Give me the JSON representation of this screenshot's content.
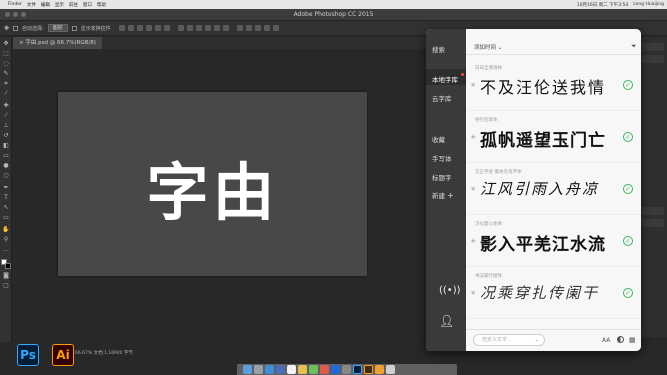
{
  "menubar": {
    "items": [
      "Finder",
      "文件",
      "编辑",
      "显示",
      "前往",
      "窗口",
      "帮助"
    ],
    "right": [
      "10月16日 周二 下午3:54",
      "Leng Huaijing"
    ]
  },
  "app": {
    "title": "Adobe Photoshop CC 2015"
  },
  "options": {
    "auto_select_label": "自动选择:",
    "layer_select": "图层",
    "transform_label": "显示变换控件"
  },
  "document": {
    "tab": "字由.psd @ 66.7%(RGB/8)",
    "canvas_text": "字由",
    "status": "66.67%   文档:1.16M/0 字节"
  },
  "apps": {
    "ps": "Ps",
    "ai": "Ai"
  },
  "panel": {
    "sidebar": {
      "search": "搜索",
      "local": "本地字库",
      "cloud": "云字库",
      "favorites": "收藏",
      "handwriting": "手写体",
      "title_font": "标题字",
      "new": "新建",
      "new_plus": "+"
    },
    "sort_label": "添加时间 ⌄",
    "fonts": [
      {
        "name": "日日全清诗林",
        "sample": "不及汪伦送我情"
      },
      {
        "name": "经行狂草体",
        "sample": "孤帆遥望玉门亡"
      },
      {
        "name": "方正字迹-童体毛笔字体",
        "sample": "江风引雨入舟凉"
      },
      {
        "name": "汉仪菱心体简",
        "sample": "影入平羌江水流"
      },
      {
        "name": "书法家行楷体",
        "sample": "况乘穿扎传阑干"
      }
    ],
    "input_placeholder": "自定义文字...",
    "input_chevron": "⌄",
    "aa_label": "AA"
  },
  "colors": {
    "check": "#3cb85c",
    "sidebar": "#3a3a3a",
    "notify_dot": "#e84a4a"
  }
}
